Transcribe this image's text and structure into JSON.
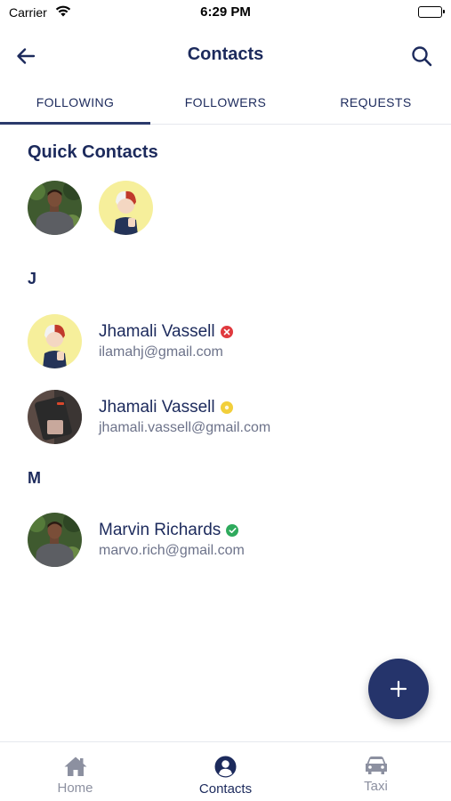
{
  "status_bar": {
    "carrier": "Carrier",
    "time": "6:29 PM"
  },
  "header": {
    "title": "Contacts"
  },
  "tabs": [
    {
      "label": "FOLLOWING",
      "active": true
    },
    {
      "label": "FOLLOWERS",
      "active": false
    },
    {
      "label": "REQUESTS",
      "active": false
    }
  ],
  "quick_contacts": {
    "title": "Quick Contacts"
  },
  "sections": [
    {
      "letter": "J",
      "contacts": [
        {
          "name": "Jhamali Vassell",
          "email": "ilamahj@gmail.com",
          "status": "blocked",
          "status_color": "#e0393e"
        },
        {
          "name": "Jhamali Vassell",
          "email": "jhamali.vassell@gmail.com",
          "status": "pending",
          "status_color": "#f2cf3b"
        }
      ]
    },
    {
      "letter": "M",
      "contacts": [
        {
          "name": "Marvin Richards",
          "email": "marvo.rich@gmail.com",
          "status": "verified",
          "status_color": "#2eaa5c"
        }
      ]
    }
  ],
  "fab": {
    "icon": "plus-icon"
  },
  "bottom_nav": [
    {
      "label": "Home",
      "icon": "home-icon",
      "active": false
    },
    {
      "label": "Contacts",
      "icon": "user-circle-icon",
      "active": true
    },
    {
      "label": "Taxi",
      "icon": "car-icon",
      "active": false
    }
  ],
  "colors": {
    "primary": "#1c2a5c",
    "fab": "#25346b",
    "muted": "#6d738a"
  }
}
